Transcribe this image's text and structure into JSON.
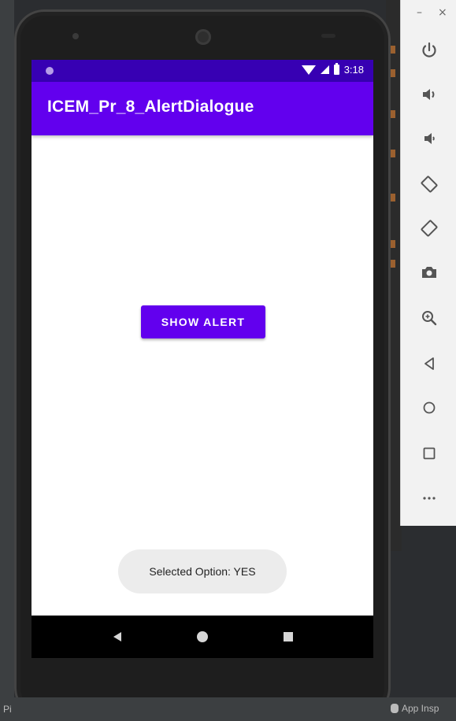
{
  "ide": {
    "bottom_left_text": "Pi",
    "bottom_right_text": "App Insp"
  },
  "window": {
    "minimize_symbol": "–",
    "close_symbol": "×"
  },
  "toolbar": {
    "items": [
      {
        "name": "power-icon"
      },
      {
        "name": "volume-up-icon"
      },
      {
        "name": "volume-down-icon"
      },
      {
        "name": "rotate-left-icon"
      },
      {
        "name": "rotate-right-icon"
      },
      {
        "name": "camera-icon"
      },
      {
        "name": "zoom-icon"
      },
      {
        "name": "back-icon"
      },
      {
        "name": "home-icon"
      },
      {
        "name": "overview-icon"
      },
      {
        "name": "more-icon"
      }
    ]
  },
  "status_bar": {
    "time": "3:18",
    "color": "#3700b3"
  },
  "app_bar": {
    "title": "ICEM_Pr_8_AlertDialogue",
    "color": "#6200ee"
  },
  "main": {
    "button_label": "SHOW ALERT"
  },
  "toast": {
    "message": "Selected Option: YES"
  }
}
